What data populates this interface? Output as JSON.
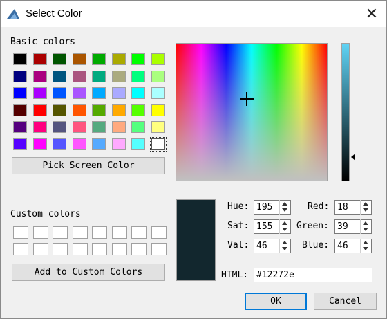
{
  "window": {
    "title": "Select Color",
    "close_glyph": "✕"
  },
  "basic": {
    "label": "Basic colors",
    "colors": [
      [
        "#000000",
        "#aa0000",
        "#005500",
        "#aa5500",
        "#00aa00",
        "#aaaa00",
        "#00ff00",
        "#aaff00"
      ],
      [
        "#00007f",
        "#aa007f",
        "#00557f",
        "#aa557f",
        "#00aa7f",
        "#aaaa7f",
        "#00ff7f",
        "#aaff7f"
      ],
      [
        "#0000ff",
        "#aa00ff",
        "#0055ff",
        "#aa55ff",
        "#00aaff",
        "#aaaaff",
        "#00ffff",
        "#aaffff"
      ],
      [
        "#550000",
        "#ff0000",
        "#555500",
        "#ff5500",
        "#55aa00",
        "#ffaa00",
        "#55ff00",
        "#ffff00"
      ],
      [
        "#55007f",
        "#ff007f",
        "#55557f",
        "#ff557f",
        "#55aa7f",
        "#ffaa7f",
        "#55ff7f",
        "#ffff7f"
      ],
      [
        "#5500ff",
        "#ff00ff",
        "#5555ff",
        "#ff55ff",
        "#55aaff",
        "#ffaaff",
        "#55ffff",
        "#ffffff"
      ]
    ],
    "selected": [
      5,
      7
    ]
  },
  "pick_button": "Pick Screen Color",
  "custom": {
    "label": "Custom colors",
    "rows": 2,
    "cols": 8,
    "fill": "#ffffff"
  },
  "add_button": "Add to Custom Colors",
  "current_color": "#12272e",
  "lum_gradient": [
    "#5fd3f5",
    "#000000"
  ],
  "fields": {
    "hue": {
      "label": "Hue:",
      "value": "195"
    },
    "sat": {
      "label": "Sat:",
      "value": "155"
    },
    "val": {
      "label": "Val:",
      "value": "46"
    },
    "red": {
      "label": "Red:",
      "value": "18"
    },
    "green": {
      "label": "Green:",
      "value": "39"
    },
    "blue": {
      "label": "Blue:",
      "value": "46"
    }
  },
  "html": {
    "label": "HTML:",
    "value": "#12272e"
  },
  "ok_button": "OK",
  "cancel_button": "Cancel",
  "accent_color": "#0078d7"
}
